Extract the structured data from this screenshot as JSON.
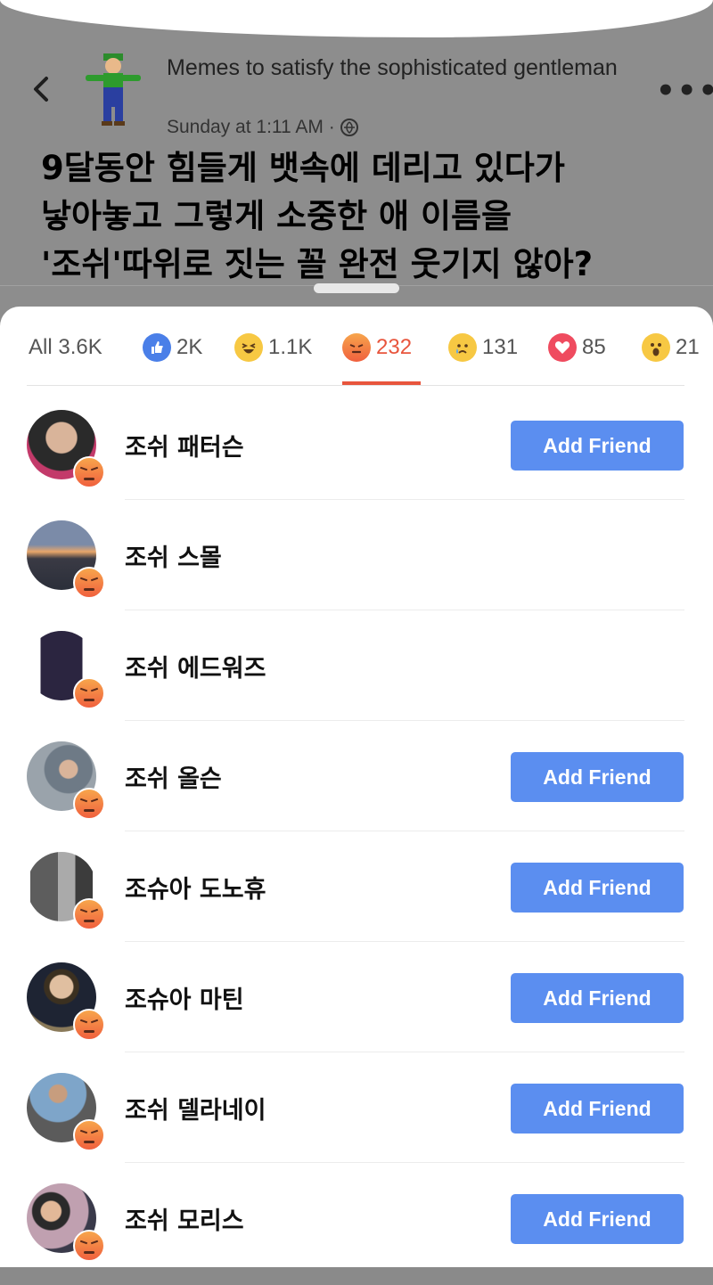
{
  "post": {
    "page_name": "Memes to satisfy the sophisticated gentleman",
    "time": "Sunday at 1:11 AM ·",
    "more_icon": "more-icon",
    "back_icon": "back-icon"
  },
  "caption": {
    "lines": [
      "9달동안 힘들게 뱃속에 데리고 있다가",
      "낳아놓고 그렇게 소중한 애 이름을",
      "'조쉬'따위로 짓는 꼴 완전 웃기지 않아?"
    ]
  },
  "tabs": [
    {
      "label": "All 3.6K",
      "icon": ""
    },
    {
      "label": "2K",
      "icon": "like-icon"
    },
    {
      "label": "1.1K",
      "icon": "haha-icon"
    },
    {
      "label": "232",
      "icon": "angry-icon"
    },
    {
      "label": "131",
      "icon": "sad-icon"
    },
    {
      "label": "85",
      "icon": "love-icon"
    },
    {
      "label": "21",
      "icon": "wow-icon"
    }
  ],
  "people": [
    {
      "name": "조쉬 패터슨",
      "button": "Add Friend"
    },
    {
      "name": "조쉬 스몰",
      "button": ""
    },
    {
      "name": "조쉬 에드워즈",
      "button": ""
    },
    {
      "name": "조쉬 올슨",
      "button": "Add Friend"
    },
    {
      "name": "조슈아 도노휴",
      "button": "Add Friend"
    },
    {
      "name": "조슈아 마틴",
      "button": "Add Friend"
    },
    {
      "name": "조쉬 델라네이",
      "button": "Add Friend"
    },
    {
      "name": "조쉬 모리스",
      "button": "Add Friend"
    }
  ],
  "colors": {
    "accent": "#e8553d",
    "button": "#5b8ef0",
    "like": "#4a7fe8"
  }
}
